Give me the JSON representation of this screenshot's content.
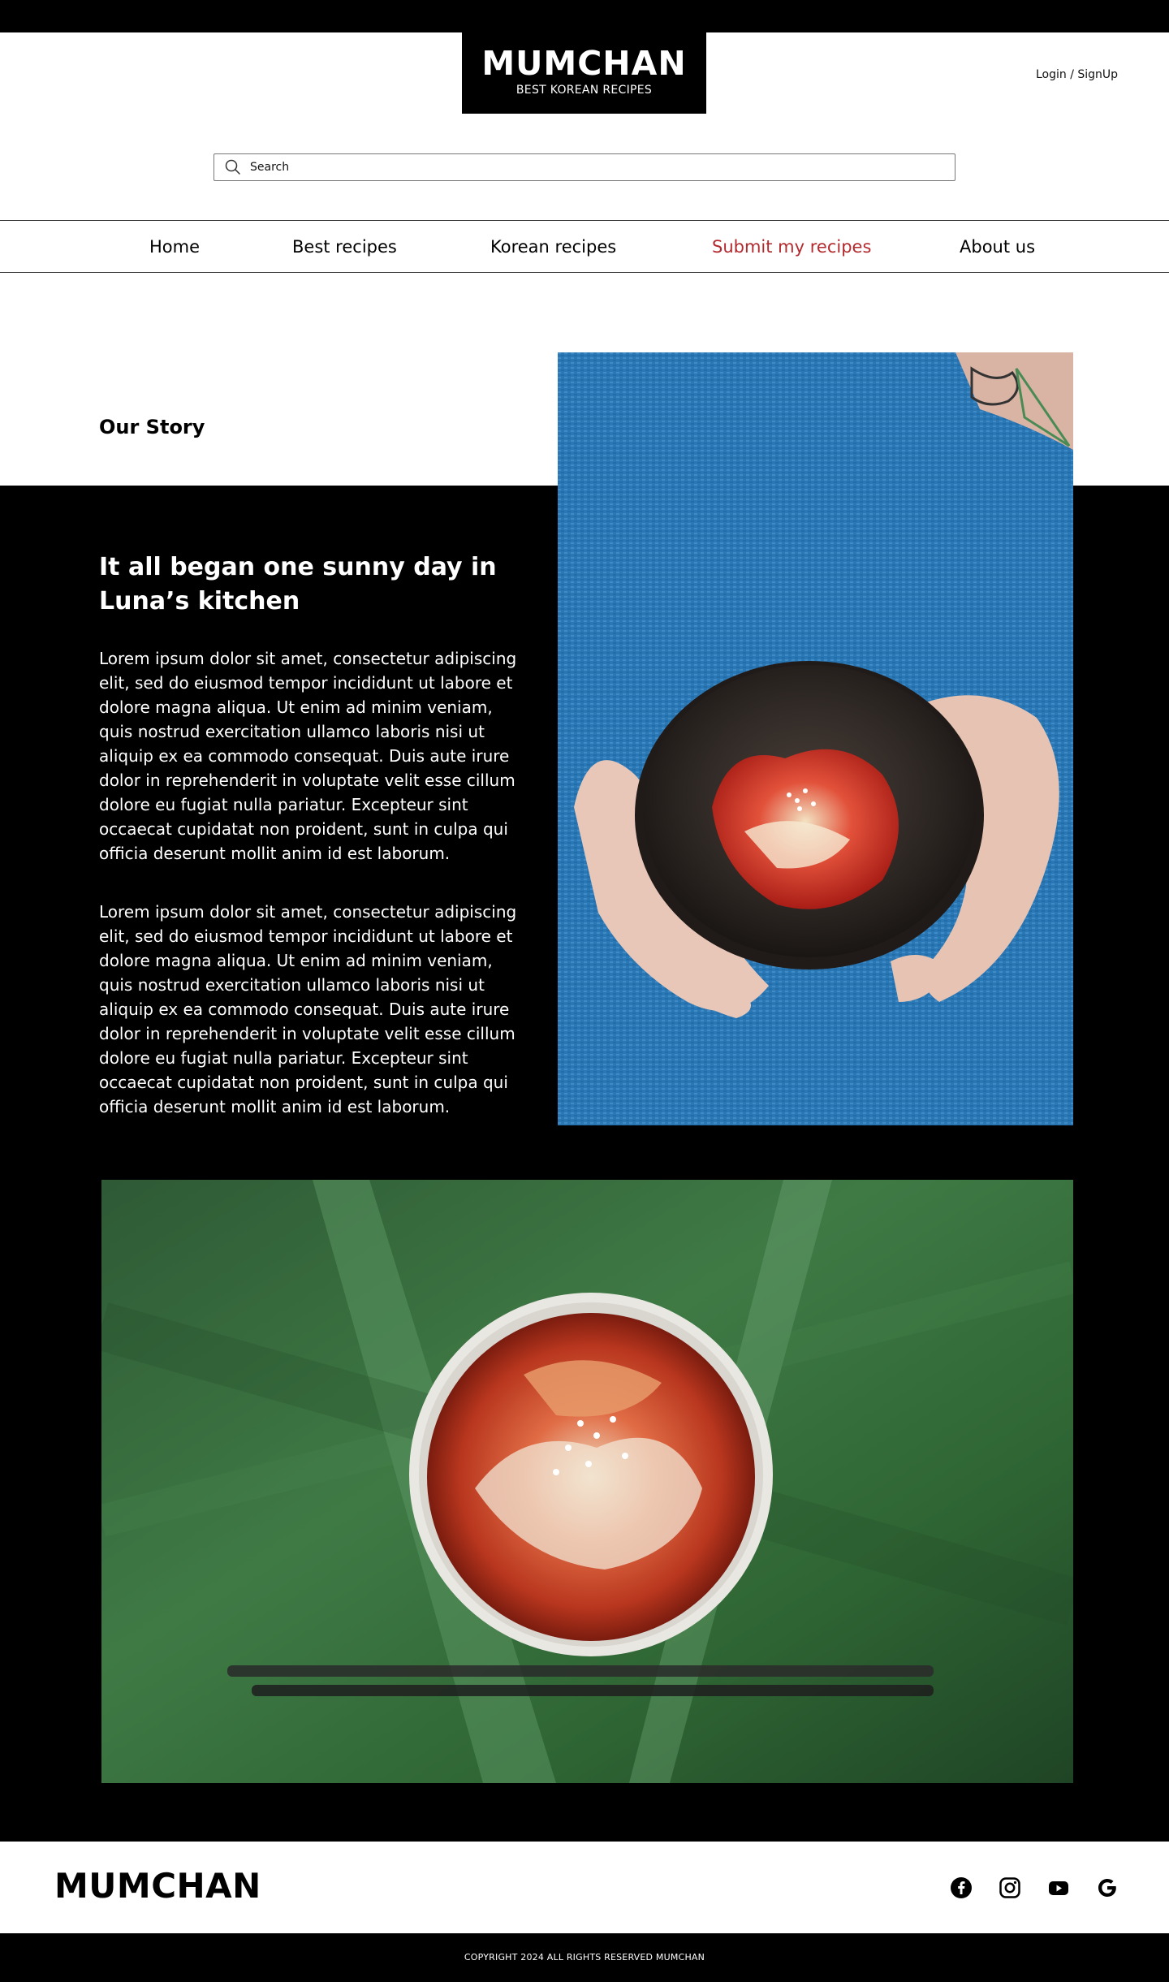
{
  "brand": {
    "name": "MUMCHAN",
    "tagline": "BEST KOREAN RECIPES"
  },
  "header": {
    "login_label": "Login / SignUp"
  },
  "search": {
    "placeholder": "Search",
    "value": ""
  },
  "nav": {
    "items": [
      {
        "label": "Home"
      },
      {
        "label": "Best recipes"
      },
      {
        "label": "Korean recipes"
      },
      {
        "label": "Submit my recipes"
      },
      {
        "label": "About us"
      }
    ],
    "active_item": "Submit my recipes",
    "active_color": "#b32a2e"
  },
  "story": {
    "section_label": "Our Story",
    "heading": "It all began one sunny day in Luna’s kitchen",
    "paragraphs": [
      "Lorem ipsum dolor sit amet, consectetur adipiscing elit, sed do eiusmod tempor incididunt ut labore et dolore magna aliqua. Ut enim ad minim veniam, quis nostrud exercitation ullamco laboris nisi ut aliquip ex ea commodo consequat. Duis aute irure dolor in reprehenderit in voluptate velit esse cillum dolore eu fugiat nulla pariatur. Excepteur sint occaecat cupidatat non proident, sunt in culpa qui officia deserunt mollit anim id est laborum.",
      "Lorem ipsum dolor sit amet, consectetur adipiscing elit, sed do eiusmod tempor incididunt ut labore et dolore magna aliqua. Ut enim ad minim veniam, quis nostrud exercitation ullamco laboris nisi ut aliquip ex ea commodo consequat. Duis aute irure dolor in reprehenderit in voluptate velit esse cillum dolore eu fugiat nulla pariatur. Excepteur sint occaecat cupidatat non proident, sunt in culpa qui officia deserunt mollit anim id est laborum."
    ]
  },
  "footer": {
    "logo": "MUMCHAN",
    "social_icons": [
      "facebook-icon",
      "instagram-icon",
      "youtube-icon",
      "google-icon"
    ],
    "copyright": "COPYRIGHT 2024 ALL RIGHTS RESERVED MUMCHAN"
  },
  "colors": {
    "primary": "#000000",
    "background": "#ffffff",
    "accent": "#b32a2e"
  }
}
